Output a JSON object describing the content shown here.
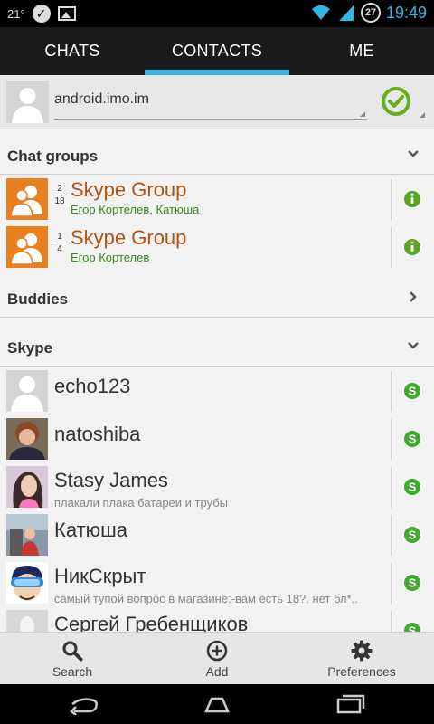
{
  "status_bar": {
    "temperature": "21°",
    "notification_count": "27",
    "time": "19:49",
    "icons": [
      "check-circle-icon",
      "image-icon",
      "wifi-icon",
      "signal-icon"
    ]
  },
  "tabs": [
    {
      "label": "CHATS",
      "active": false
    },
    {
      "label": "CONTACTS",
      "active": true
    },
    {
      "label": "ME",
      "active": false
    }
  ],
  "account": {
    "name": "android.imo.im",
    "status": "online"
  },
  "sections": {
    "chat_groups": "Chat groups",
    "buddies": "Buddies",
    "skype": "Skype"
  },
  "chat_groups": [
    {
      "online": "2",
      "total": "18",
      "name": "Skype Group",
      "members": "Егор Кортелев, Катюша"
    },
    {
      "online": "1",
      "total": "4",
      "name": "Skype Group",
      "members": "Егор Кортелев"
    }
  ],
  "skype_contacts": [
    {
      "name": "echo123",
      "status": ""
    },
    {
      "name": "natoshiba",
      "status": ""
    },
    {
      "name": "Stasy James",
      "status": "плакали плака батареи и трубы"
    },
    {
      "name": "Катюша",
      "status": ""
    },
    {
      "name": "НикСкрыт",
      "status": "самый тупой вопрос в магазине:-вам есть 18?. нет бл*.."
    },
    {
      "name": "Сергей Гребенщиков",
      "status": ""
    }
  ],
  "actions": [
    {
      "label": "Search",
      "icon": "search-icon"
    },
    {
      "label": "Add",
      "icon": "add-icon"
    },
    {
      "label": "Preferences",
      "icon": "gear-icon"
    }
  ],
  "colors": {
    "accent": "#33b5e5",
    "group_name": "#b35312",
    "group_members": "#3a8a22",
    "online_green": "#6aae1f",
    "skype_green": "#3fab2a"
  }
}
